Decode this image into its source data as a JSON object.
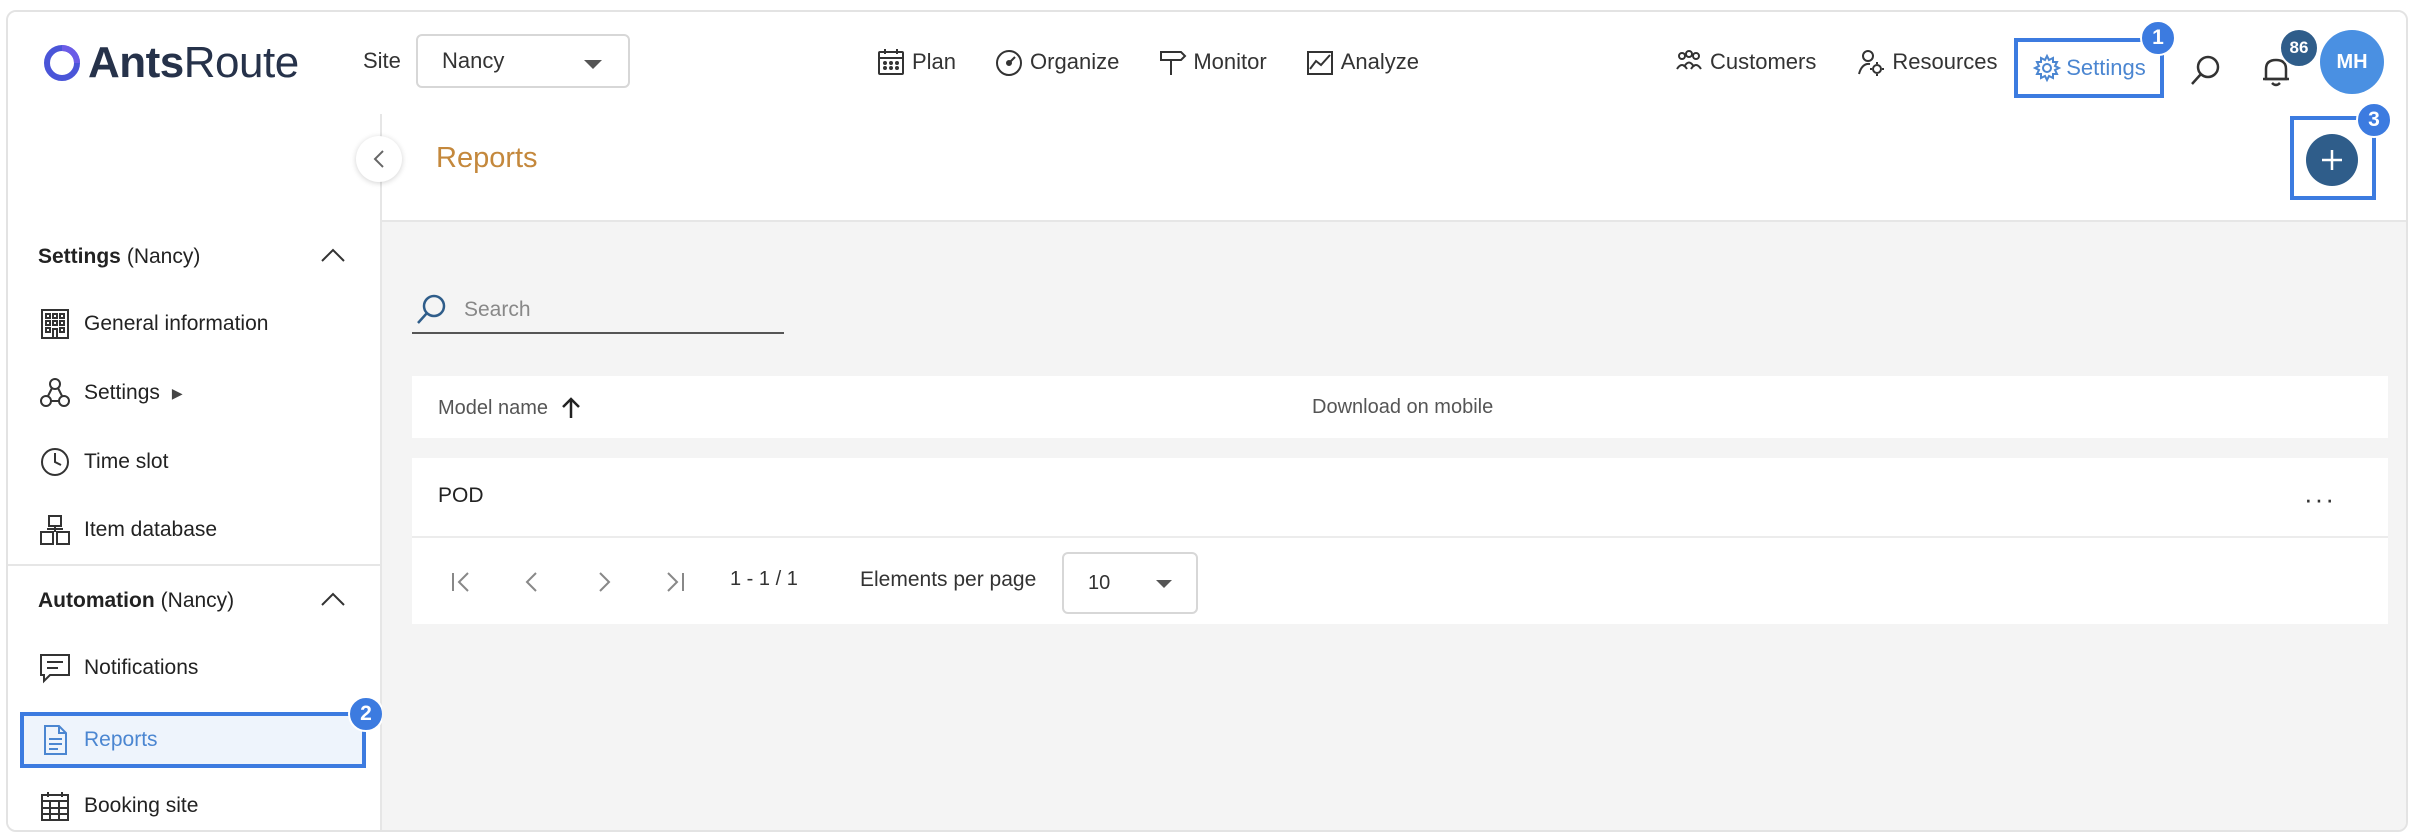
{
  "brand": {
    "name_bold": "Ants",
    "name_light": "Route",
    "accent": "#2f5d8a"
  },
  "header": {
    "site_label": "Site",
    "site_value": "Nancy",
    "nav": [
      {
        "label": "Plan",
        "icon": "calendar-icon"
      },
      {
        "label": "Organize",
        "icon": "gauge-icon"
      },
      {
        "label": "Monitor",
        "icon": "signpost-icon"
      },
      {
        "label": "Analyze",
        "icon": "chart-icon"
      }
    ],
    "right_nav": [
      {
        "label": "Customers",
        "icon": "customers-icon"
      },
      {
        "label": "Resources",
        "icon": "resources-icon"
      },
      {
        "label": "Settings",
        "icon": "gear-icon"
      }
    ],
    "notification_count": "86",
    "avatar_initials": "MH"
  },
  "steps": {
    "one": "1",
    "two": "2",
    "three": "3",
    "color": "#3c7be0"
  },
  "sidebar": {
    "settings_section": {
      "title": "Settings",
      "site": "(Nancy)"
    },
    "settings_items": [
      {
        "label": "General information",
        "icon": "building-icon"
      },
      {
        "label": "Settings",
        "icon": "settings-nodes-icon",
        "suffix": "▶"
      },
      {
        "label": "Time slot",
        "icon": "clock-icon"
      },
      {
        "label": "Item database",
        "icon": "boxes-icon"
      }
    ],
    "automation_section": {
      "title": "Automation",
      "site": "(Nancy)"
    },
    "automation_items": [
      {
        "label": "Notifications",
        "icon": "message-icon"
      },
      {
        "label": "Reports",
        "icon": "document-icon",
        "active": true
      },
      {
        "label": "Booking site",
        "icon": "calendar-grid-icon"
      }
    ]
  },
  "main": {
    "title": "Reports",
    "search_placeholder": "Search",
    "columns": {
      "model_name": "Model name",
      "download_on_mobile": "Download on mobile"
    },
    "rows": [
      {
        "model_name": "POD",
        "menu": "···"
      }
    ],
    "pager": {
      "range": "1 - 1 / 1",
      "per_page_label": "Elements per page",
      "per_page_value": "10"
    }
  }
}
